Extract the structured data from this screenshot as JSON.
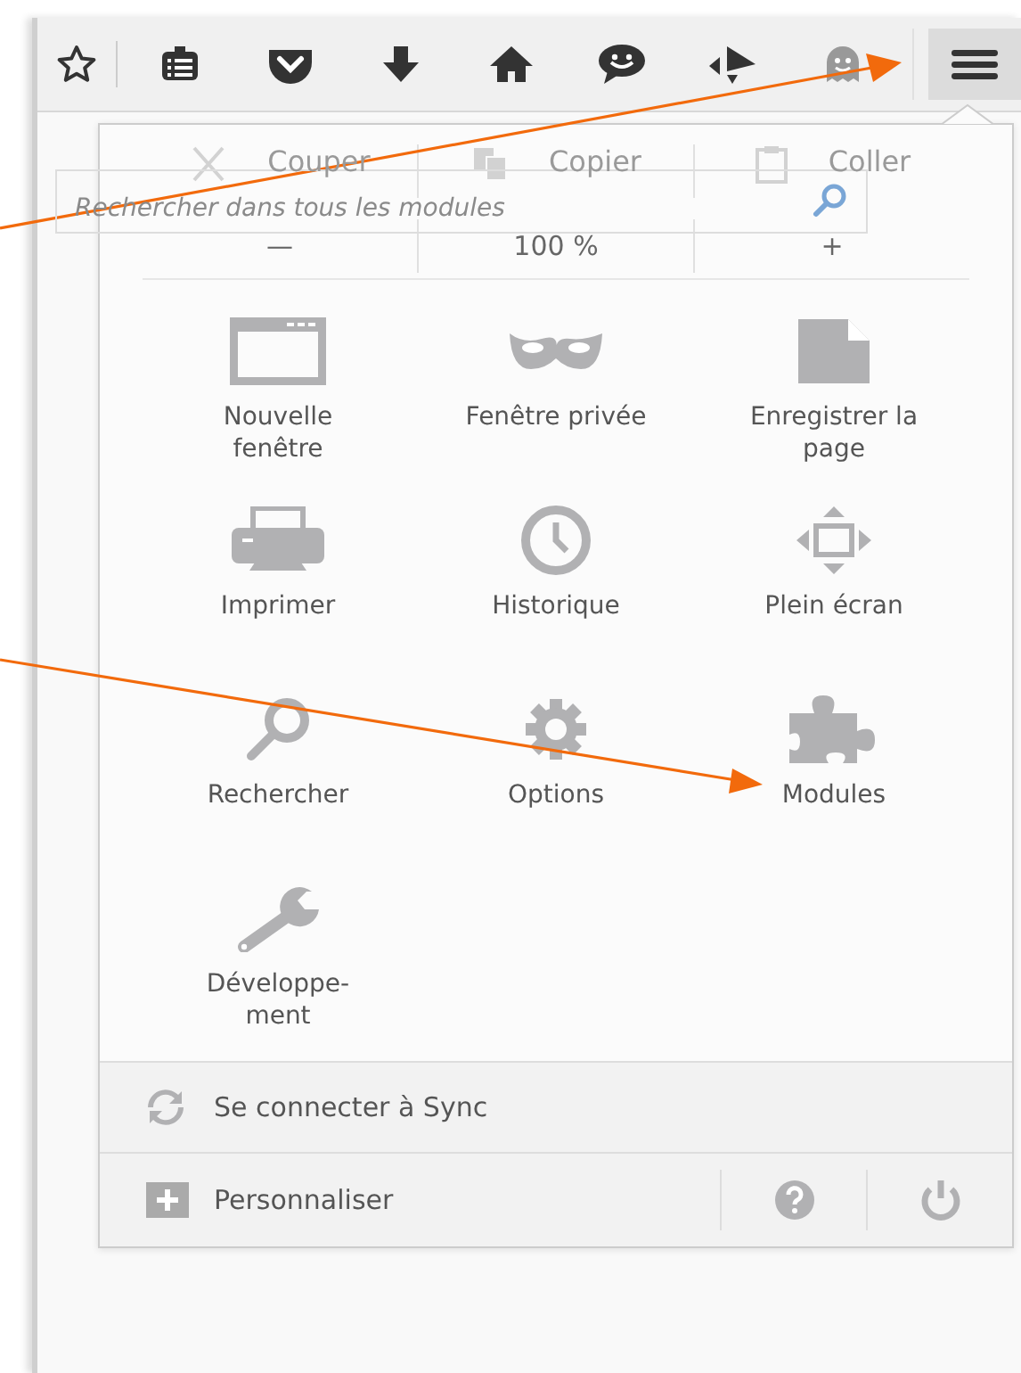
{
  "toolbar": {
    "icons": [
      {
        "kind": "star",
        "pressed": false
      },
      {
        "kind": "reader",
        "pressed": false
      },
      {
        "kind": "pocket",
        "pressed": false
      },
      {
        "kind": "download",
        "pressed": false
      },
      {
        "kind": "home",
        "pressed": false
      },
      {
        "kind": "chat",
        "pressed": false
      },
      {
        "kind": "shapes",
        "pressed": false
      },
      {
        "kind": "ghost",
        "pressed": false
      },
      {
        "kind": "menu",
        "pressed": true
      }
    ]
  },
  "search": {
    "placeholder": "Rechercher dans tous les modules"
  },
  "menu_panel": {
    "edit_row": [
      {
        "kind": "cut",
        "label": "Couper",
        "disabled": true
      },
      {
        "kind": "copy",
        "label": "Copier",
        "disabled": true
      },
      {
        "kind": "paste",
        "label": "Coller",
        "disabled": true
      }
    ],
    "zoom_row": {
      "minus": "—",
      "value": "100 %",
      "plus": "+"
    },
    "items": [
      {
        "kind": "window",
        "label": "Nouvelle\nfenêtre"
      },
      {
        "kind": "mask",
        "label": "Fenêtre privée"
      },
      {
        "kind": "page",
        "label": "Enregistrer la\npage"
      },
      {
        "kind": "printer",
        "label": "Imprimer"
      },
      {
        "kind": "clock",
        "label": "Historique"
      },
      {
        "kind": "fullscreen",
        "label": "Plein écran"
      },
      {
        "kind": "search",
        "label": "Rechercher"
      },
      {
        "kind": "gear",
        "label": "Options"
      },
      {
        "kind": "puzzle",
        "label": "Modules"
      },
      {
        "kind": "wrench",
        "label": "Développe-\nment"
      }
    ],
    "sync": {
      "label": "Se connecter à Sync"
    },
    "footer": {
      "customize": "Personnaliser"
    }
  }
}
